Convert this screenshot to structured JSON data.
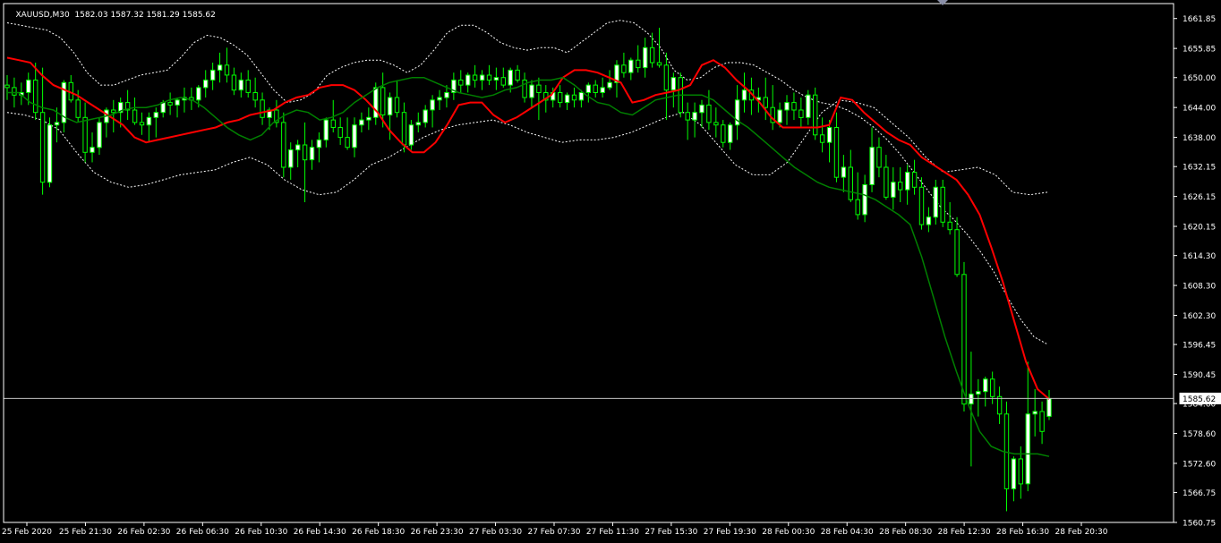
{
  "window": {
    "symbol": "XAUUSD,M30",
    "ohlc": "1582.03 1587.32 1581.29 1585.62"
  },
  "colors": {
    "background": "#000000",
    "axis": "#ffffff",
    "bull_body": "#ffffff",
    "bear_body": "#000000",
    "wick": "#00ff00",
    "red_line": "#ff0000",
    "green_line": "#008000",
    "band": "#ffffff",
    "bid_line": "#c0c0c0"
  },
  "chart_data": {
    "type": "candlestick",
    "symbol": "XAUUSD",
    "timeframe": "M30",
    "ylim": [
      1560.75,
      1664.85
    ],
    "y_ticks": [
      "1661.85",
      "1655.85",
      "1650.00",
      "1644.00",
      "1638.00",
      "1632.15",
      "1626.15",
      "1620.15",
      "1614.30",
      "1608.30",
      "1602.30",
      "1596.45",
      "1590.45",
      "1584.60",
      "1578.60",
      "1572.60",
      "1566.75",
      "1560.75"
    ],
    "x_ticks": [
      "25 Feb 2020",
      "25 Feb 21:30",
      "26 Feb 02:30",
      "26 Feb 06:30",
      "26 Feb 10:30",
      "26 Feb 14:30",
      "26 Feb 18:30",
      "26 Feb 23:30",
      "27 Feb 03:30",
      "27 Feb 07:30",
      "27 Feb 11:30",
      "27 Feb 15:30",
      "27 Feb 19:30",
      "28 Feb 00:30",
      "28 Feb 04:30",
      "28 Feb 08:30",
      "28 Feb 12:30",
      "28 Feb 16:30",
      "28 Feb 20:30"
    ],
    "current_price": "1585.62",
    "ohlc": [
      [
        1648.5,
        1650.5,
        1645.5,
        1648.0
      ],
      [
        1648.0,
        1650.0,
        1644.0,
        1646.5
      ],
      [
        1646.5,
        1649.0,
        1644.5,
        1647.0
      ],
      [
        1647.0,
        1651.0,
        1644.5,
        1649.5
      ],
      [
        1649.5,
        1653.0,
        1641.5,
        1643.0
      ],
      [
        1643.0,
        1652.0,
        1626.5,
        1629.0
      ],
      [
        1629.0,
        1642.0,
        1628.0,
        1640.5
      ],
      [
        1640.5,
        1644.0,
        1637.0,
        1641.0
      ],
      [
        1641.0,
        1649.5,
        1639.0,
        1649.0
      ],
      [
        1649.0,
        1650.5,
        1645.0,
        1645.5
      ],
      [
        1645.5,
        1647.5,
        1641.0,
        1642.0
      ],
      [
        1642.0,
        1645.0,
        1633.0,
        1635.0
      ],
      [
        1635.0,
        1639.0,
        1633.0,
        1636.0
      ],
      [
        1636.0,
        1642.0,
        1634.5,
        1641.0
      ],
      [
        1641.0,
        1644.0,
        1638.0,
        1643.5
      ],
      [
        1643.5,
        1645.5,
        1639.0,
        1643.0
      ],
      [
        1643.0,
        1646.0,
        1640.0,
        1645.0
      ],
      [
        1645.0,
        1647.5,
        1641.5,
        1643.5
      ],
      [
        1643.5,
        1646.0,
        1640.5,
        1641.0
      ],
      [
        1641.0,
        1643.0,
        1638.5,
        1640.5
      ],
      [
        1640.5,
        1643.0,
        1637.0,
        1642.0
      ],
      [
        1642.0,
        1644.0,
        1638.0,
        1643.0
      ],
      [
        1643.0,
        1645.5,
        1642.0,
        1645.0
      ],
      [
        1645.0,
        1647.0,
        1642.5,
        1644.5
      ],
      [
        1644.5,
        1646.0,
        1642.0,
        1645.5
      ],
      [
        1645.5,
        1648.0,
        1643.0,
        1646.0
      ],
      [
        1646.0,
        1648.0,
        1643.5,
        1645.5
      ],
      [
        1645.5,
        1648.5,
        1644.0,
        1648.0
      ],
      [
        1648.0,
        1651.5,
        1646.0,
        1649.5
      ],
      [
        1649.5,
        1653.0,
        1647.5,
        1651.5
      ],
      [
        1651.5,
        1655.0,
        1649.0,
        1652.5
      ],
      [
        1652.5,
        1656.0,
        1649.0,
        1650.5
      ],
      [
        1650.5,
        1652.0,
        1646.5,
        1647.5
      ],
      [
        1647.5,
        1651.0,
        1646.0,
        1649.5
      ],
      [
        1649.5,
        1651.5,
        1646.0,
        1647.0
      ],
      [
        1647.0,
        1650.0,
        1644.0,
        1645.5
      ],
      [
        1645.5,
        1647.0,
        1640.5,
        1642.0
      ],
      [
        1642.0,
        1644.0,
        1639.5,
        1643.5
      ],
      [
        1643.5,
        1645.5,
        1640.0,
        1641.0
      ],
      [
        1641.0,
        1643.0,
        1630.0,
        1632.0
      ],
      [
        1632.0,
        1637.0,
        1629.5,
        1635.5
      ],
      [
        1635.5,
        1637.5,
        1632.0,
        1636.5
      ],
      [
        1636.5,
        1641.0,
        1625.0,
        1633.5
      ],
      [
        1633.5,
        1637.5,
        1631.5,
        1636.0
      ],
      [
        1636.0,
        1639.0,
        1633.0,
        1637.5
      ],
      [
        1637.5,
        1642.0,
        1636.0,
        1641.5
      ],
      [
        1641.5,
        1645.5,
        1639.0,
        1640.0
      ],
      [
        1640.0,
        1642.0,
        1636.5,
        1638.0
      ],
      [
        1638.0,
        1642.0,
        1635.5,
        1636.0
      ],
      [
        1636.0,
        1642.0,
        1634.0,
        1640.5
      ],
      [
        1640.5,
        1643.0,
        1639.0,
        1641.5
      ],
      [
        1641.5,
        1644.0,
        1639.5,
        1642.0
      ],
      [
        1642.0,
        1649.0,
        1640.5,
        1648.0
      ],
      [
        1648.0,
        1651.0,
        1640.0,
        1642.5
      ],
      [
        1642.5,
        1647.0,
        1637.5,
        1646.0
      ],
      [
        1646.0,
        1649.5,
        1642.0,
        1643.0
      ],
      [
        1643.0,
        1645.0,
        1635.0,
        1636.5
      ],
      [
        1636.5,
        1641.5,
        1635.5,
        1640.5
      ],
      [
        1640.5,
        1643.0,
        1639.0,
        1641.0
      ],
      [
        1641.0,
        1644.5,
        1640.0,
        1643.5
      ],
      [
        1643.5,
        1646.5,
        1640.0,
        1645.5
      ],
      [
        1645.5,
        1647.5,
        1643.5,
        1646.0
      ],
      [
        1646.0,
        1648.5,
        1644.0,
        1647.0
      ],
      [
        1647.0,
        1651.0,
        1645.5,
        1649.5
      ],
      [
        1649.5,
        1651.5,
        1647.0,
        1648.5
      ],
      [
        1648.5,
        1651.0,
        1647.0,
        1650.5
      ],
      [
        1650.5,
        1652.5,
        1648.0,
        1649.5
      ],
      [
        1649.5,
        1651.5,
        1647.5,
        1650.5
      ],
      [
        1650.5,
        1652.5,
        1648.5,
        1649.5
      ],
      [
        1649.5,
        1652.0,
        1647.5,
        1650.0
      ],
      [
        1650.0,
        1652.0,
        1648.0,
        1648.5
      ],
      [
        1648.5,
        1652.0,
        1647.0,
        1651.5
      ],
      [
        1651.5,
        1652.5,
        1649.0,
        1649.5
      ],
      [
        1649.5,
        1651.0,
        1645.0,
        1646.0
      ],
      [
        1646.0,
        1649.5,
        1644.0,
        1648.5
      ],
      [
        1648.5,
        1650.0,
        1641.5,
        1647.0
      ],
      [
        1647.0,
        1648.5,
        1643.0,
        1645.5
      ],
      [
        1645.5,
        1648.0,
        1644.0,
        1647.0
      ],
      [
        1647.0,
        1648.5,
        1644.0,
        1645.0
      ],
      [
        1645.0,
        1647.0,
        1643.5,
        1646.5
      ],
      [
        1646.5,
        1648.0,
        1644.0,
        1645.5
      ],
      [
        1645.5,
        1647.5,
        1644.0,
        1647.0
      ],
      [
        1647.0,
        1649.0,
        1645.0,
        1648.5
      ],
      [
        1648.5,
        1649.5,
        1646.0,
        1647.0
      ],
      [
        1647.0,
        1650.0,
        1646.0,
        1648.0
      ],
      [
        1648.0,
        1651.5,
        1647.5,
        1649.0
      ],
      [
        1649.0,
        1653.5,
        1646.0,
        1652.5
      ],
      [
        1652.5,
        1655.0,
        1650.0,
        1651.0
      ],
      [
        1651.0,
        1654.0,
        1649.5,
        1653.5
      ],
      [
        1653.5,
        1656.5,
        1651.0,
        1652.0
      ],
      [
        1652.0,
        1658.0,
        1650.0,
        1656.0
      ],
      [
        1656.0,
        1659.0,
        1652.0,
        1653.0
      ],
      [
        1653.0,
        1660.0,
        1652.0,
        1652.5
      ],
      [
        1652.5,
        1655.0,
        1641.5,
        1647.5
      ],
      [
        1647.5,
        1651.0,
        1644.0,
        1650.0
      ],
      [
        1650.0,
        1651.0,
        1642.0,
        1643.0
      ],
      [
        1643.0,
        1645.0,
        1637.5,
        1641.5
      ],
      [
        1641.5,
        1645.0,
        1638.0,
        1643.0
      ],
      [
        1643.0,
        1645.5,
        1640.0,
        1644.5
      ],
      [
        1644.5,
        1647.5,
        1639.5,
        1641.0
      ],
      [
        1641.0,
        1644.0,
        1638.0,
        1640.5
      ],
      [
        1640.5,
        1641.5,
        1636.0,
        1637.0
      ],
      [
        1637.0,
        1641.0,
        1635.5,
        1640.5
      ],
      [
        1640.5,
        1648.5,
        1637.5,
        1645.5
      ],
      [
        1645.5,
        1651.0,
        1643.0,
        1647.5
      ],
      [
        1647.5,
        1650.0,
        1642.5,
        1645.5
      ],
      [
        1645.5,
        1648.0,
        1643.0,
        1646.0
      ],
      [
        1646.0,
        1650.0,
        1641.5,
        1644.0
      ],
      [
        1644.0,
        1648.5,
        1639.5,
        1641.0
      ],
      [
        1641.0,
        1645.0,
        1640.0,
        1643.5
      ],
      [
        1643.5,
        1646.5,
        1640.5,
        1645.0
      ],
      [
        1645.0,
        1647.0,
        1641.5,
        1643.5
      ],
      [
        1643.5,
        1646.0,
        1640.0,
        1642.0
      ],
      [
        1642.0,
        1647.5,
        1640.5,
        1646.5
      ],
      [
        1646.5,
        1648.0,
        1637.5,
        1638.5
      ],
      [
        1638.5,
        1642.0,
        1635.0,
        1637.0
      ],
      [
        1637.0,
        1641.5,
        1633.0,
        1640.0
      ],
      [
        1640.0,
        1643.0,
        1629.0,
        1630.0
      ],
      [
        1630.0,
        1634.5,
        1627.0,
        1632.0
      ],
      [
        1632.0,
        1635.5,
        1625.0,
        1625.5
      ],
      [
        1625.5,
        1631.0,
        1621.5,
        1622.5
      ],
      [
        1622.5,
        1630.5,
        1621.0,
        1628.5
      ],
      [
        1628.5,
        1640.0,
        1627.0,
        1636.0
      ],
      [
        1636.0,
        1638.0,
        1630.0,
        1632.0
      ],
      [
        1632.0,
        1634.5,
        1625.5,
        1626.0
      ],
      [
        1626.0,
        1632.0,
        1623.5,
        1629.0
      ],
      [
        1629.0,
        1632.0,
        1625.0,
        1627.5
      ],
      [
        1627.5,
        1632.5,
        1624.5,
        1631.0
      ],
      [
        1631.0,
        1633.5,
        1626.5,
        1628.0
      ],
      [
        1628.0,
        1630.0,
        1619.5,
        1620.5
      ],
      [
        1620.5,
        1624.0,
        1619.0,
        1622.0
      ],
      [
        1622.0,
        1629.5,
        1620.5,
        1628.0
      ],
      [
        1628.0,
        1629.5,
        1620.0,
        1621.0
      ],
      [
        1621.0,
        1625.0,
        1618.5,
        1619.5
      ],
      [
        1619.5,
        1622.0,
        1610.0,
        1610.5
      ],
      [
        1610.5,
        1613.0,
        1583.0,
        1584.5
      ],
      [
        1584.5,
        1595.0,
        1572.0,
        1586.5
      ],
      [
        1586.5,
        1589.5,
        1582.0,
        1587.0
      ],
      [
        1587.0,
        1590.0,
        1584.0,
        1589.5
      ],
      [
        1589.5,
        1591.0,
        1584.5,
        1586.0
      ],
      [
        1586.0,
        1588.0,
        1580.5,
        1582.5
      ],
      [
        1582.5,
        1585.0,
        1563.0,
        1567.5
      ],
      [
        1567.5,
        1574.0,
        1565.0,
        1573.5
      ],
      [
        1573.5,
        1576.0,
        1565.5,
        1568.5
      ],
      [
        1568.5,
        1593.0,
        1567.0,
        1582.5
      ],
      [
        1582.5,
        1587.5,
        1578.0,
        1583.0
      ],
      [
        1583.0,
        1585.0,
        1576.5,
        1579.0
      ],
      [
        1582.03,
        1587.32,
        1581.29,
        1585.62
      ]
    ],
    "red_line": [
      1654.0,
      1653.5,
      1653.0,
      1650.5,
      1648.5,
      1647.5,
      1646.5,
      1645.0,
      1643.5,
      1642.0,
      1640.5,
      1638.0,
      1637.0,
      1637.5,
      1638.0,
      1638.5,
      1639.0,
      1639.5,
      1640.0,
      1641.0,
      1641.5,
      1642.5,
      1643.0,
      1643.5,
      1645.0,
      1646.0,
      1646.5,
      1648.0,
      1648.5,
      1648.5,
      1647.5,
      1645.5,
      1643.0,
      1639.5,
      1637.0,
      1635.0,
      1635.0,
      1637.0,
      1640.5,
      1644.5,
      1645.0,
      1645.0,
      1642.5,
      1641.0,
      1642.0,
      1643.5,
      1645.0,
      1646.5,
      1650.0,
      1651.5,
      1651.5,
      1651.0,
      1650.0,
      1649.0,
      1645.0,
      1645.5,
      1646.5,
      1647.0,
      1647.5,
      1648.5,
      1652.5,
      1653.5,
      1652.0,
      1649.5,
      1647.5,
      1645.0,
      1642.0,
      1640.0,
      1640.0,
      1640.0,
      1640.0,
      1640.5,
      1646.0,
      1645.5,
      1643.0,
      1641.0,
      1639.0,
      1637.5,
      1636.5,
      1634.0,
      1632.5,
      1631.0,
      1629.5,
      1626.5,
      1622.5,
      1616.0,
      1609.0,
      1601.0,
      1593.0,
      1587.5,
      1585.5
    ],
    "green_line": [
      1647.0,
      1647.0,
      1645.0,
      1644.0,
      1643.5,
      1642.0,
      1641.0,
      1641.5,
      1642.0,
      1642.5,
      1643.5,
      1644.0,
      1644.0,
      1644.5,
      1645.5,
      1646.0,
      1645.5,
      1644.0,
      1642.0,
      1640.0,
      1638.5,
      1637.5,
      1638.5,
      1641.0,
      1642.5,
      1643.5,
      1643.0,
      1641.5,
      1642.0,
      1643.0,
      1645.0,
      1646.5,
      1648.0,
      1649.0,
      1649.5,
      1650.0,
      1650.0,
      1649.0,
      1648.0,
      1647.0,
      1646.5,
      1646.0,
      1646.5,
      1647.5,
      1648.0,
      1649.0,
      1649.5,
      1649.5,
      1650.0,
      1648.5,
      1646.5,
      1645.0,
      1644.5,
      1643.0,
      1642.5,
      1644.0,
      1645.5,
      1646.0,
      1646.5,
      1646.5,
      1646.5,
      1645.5,
      1643.5,
      1641.5,
      1640.0,
      1638.0,
      1636.0,
      1634.0,
      1632.0,
      1630.5,
      1629.0,
      1628.0,
      1627.5,
      1627.0,
      1626.5,
      1625.5,
      1624.0,
      1622.5,
      1620.5,
      1614.0,
      1606.0,
      1598.0,
      1591.0,
      1584.5,
      1579.0,
      1576.0,
      1575.0,
      1574.5,
      1574.5,
      1574.5,
      1574.0
    ],
    "upper_band": [
      1661.0,
      1660.5,
      1660.0,
      1659.5,
      1658.0,
      1655.0,
      1651.0,
      1648.5,
      1648.5,
      1649.5,
      1650.5,
      1651.0,
      1651.5,
      1654.0,
      1657.0,
      1658.5,
      1658.0,
      1656.5,
      1654.5,
      1651.0,
      1647.5,
      1645.0,
      1645.5,
      1647.0,
      1650.5,
      1652.0,
      1653.0,
      1653.5,
      1653.5,
      1652.5,
      1651.0,
      1652.5,
      1655.5,
      1659.0,
      1660.5,
      1660.5,
      1659.0,
      1657.0,
      1656.0,
      1655.5,
      1656.0,
      1656.0,
      1655.0,
      1657.0,
      1659.0,
      1661.0,
      1661.5,
      1661.0,
      1659.0,
      1656.0,
      1651.5,
      1649.5,
      1650.0,
      1652.0,
      1653.0,
      1653.0,
      1652.5,
      1651.0,
      1649.5,
      1647.5,
      1646.0,
      1645.0,
      1644.5,
      1643.5,
      1642.0,
      1640.0,
      1637.5,
      1634.5,
      1631.0,
      1627.5,
      1624.0,
      1621.5,
      1618.5,
      1615.0,
      1611.0,
      1606.0,
      1601.5,
      1598.0,
      1596.5
    ],
    "lower_band": [
      1643.0,
      1642.5,
      1641.5,
      1639.5,
      1635.0,
      1631.0,
      1629.0,
      1628.0,
      1628.5,
      1629.5,
      1630.5,
      1631.0,
      1631.5,
      1633.0,
      1634.0,
      1632.5,
      1629.5,
      1627.5,
      1626.5,
      1627.0,
      1629.5,
      1632.5,
      1634.0,
      1636.0,
      1638.0,
      1639.5,
      1640.5,
      1641.0,
      1641.5,
      1640.5,
      1639.0,
      1638.0,
      1637.0,
      1637.5,
      1637.5,
      1638.0,
      1639.0,
      1640.5,
      1642.0,
      1643.0,
      1640.5,
      1636.5,
      1632.5,
      1630.5,
      1630.5,
      1633.0,
      1638.0,
      1643.0,
      1645.5,
      1645.0,
      1644.0,
      1641.0,
      1638.0,
      1634.0,
      1631.0,
      1631.5,
      1632.0,
      1630.5,
      1627.0,
      1626.5,
      1627.0
    ]
  }
}
